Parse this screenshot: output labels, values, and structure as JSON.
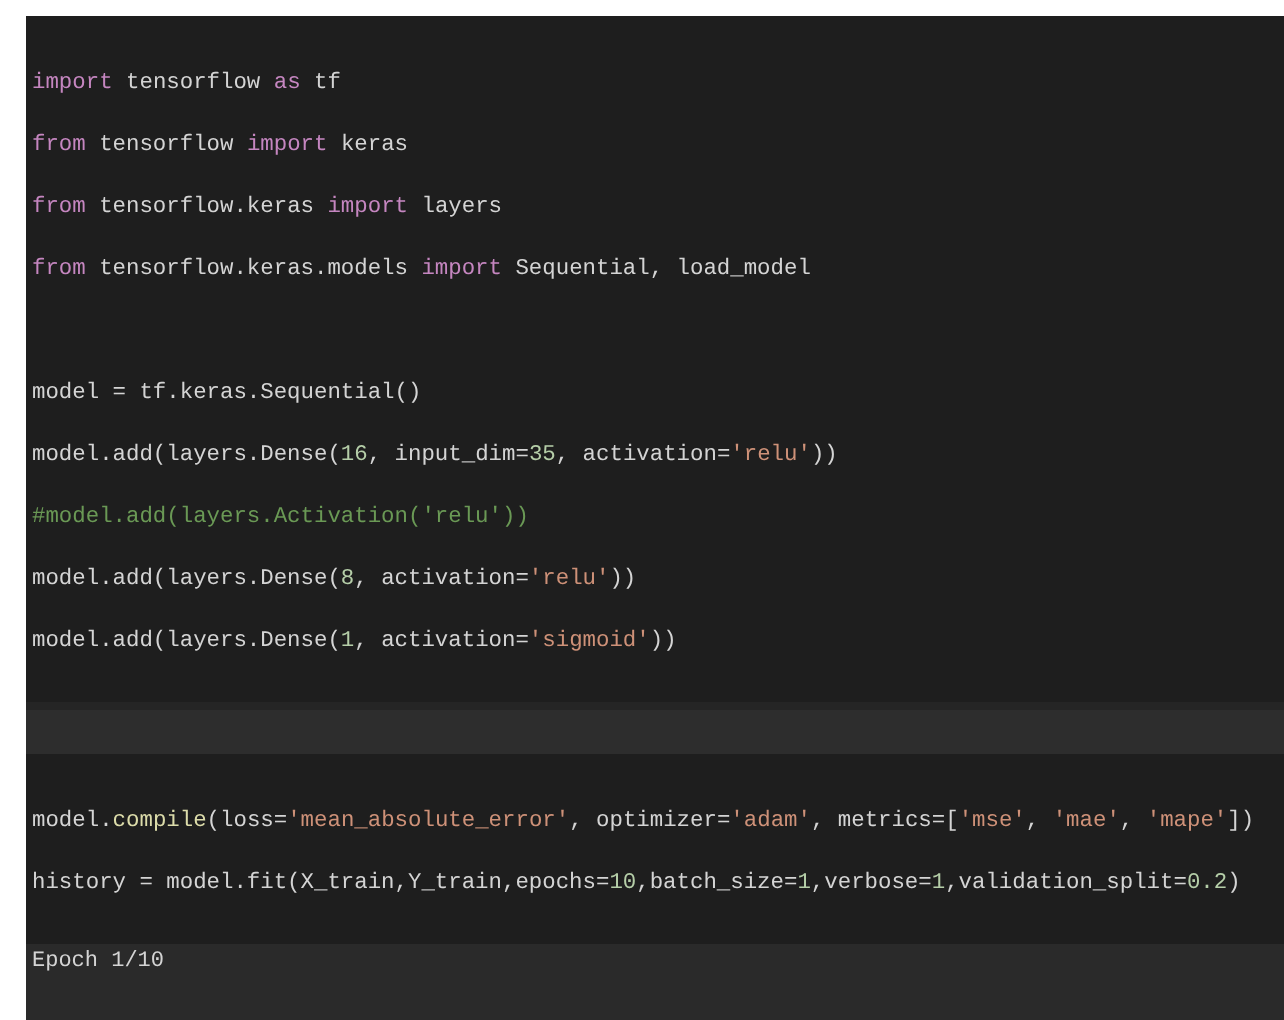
{
  "cells": [
    {
      "groups": [
        [
          [
            {
              "kind": "keyword",
              "text": "import"
            },
            {
              "kind": "plain",
              "text": " tensorflow "
            },
            {
              "kind": "keyword",
              "text": "as"
            },
            {
              "kind": "plain",
              "text": " tf"
            }
          ],
          [
            {
              "kind": "keyword",
              "text": "from"
            },
            {
              "kind": "plain",
              "text": " tensorflow "
            },
            {
              "kind": "keyword",
              "text": "import"
            },
            {
              "kind": "plain",
              "text": " keras"
            }
          ],
          [
            {
              "kind": "keyword",
              "text": "from"
            },
            {
              "kind": "plain",
              "text": " tensorflow.keras "
            },
            {
              "kind": "keyword",
              "text": "import"
            },
            {
              "kind": "plain",
              "text": " layers"
            }
          ],
          [
            {
              "kind": "keyword",
              "text": "from"
            },
            {
              "kind": "plain",
              "text": " tensorflow.keras.models "
            },
            {
              "kind": "keyword",
              "text": "import"
            },
            {
              "kind": "plain",
              "text": " Sequential, load_model"
            }
          ]
        ],
        [
          [
            {
              "kind": "plain",
              "text": "model = tf.keras.Sequential()"
            }
          ],
          [
            {
              "kind": "plain",
              "text": "model.add(layers.Dense("
            },
            {
              "kind": "number",
              "text": "16"
            },
            {
              "kind": "plain",
              "text": ", input_dim="
            },
            {
              "kind": "number",
              "text": "35"
            },
            {
              "kind": "plain",
              "text": ", activation="
            },
            {
              "kind": "string",
              "text": "'relu'"
            },
            {
              "kind": "plain",
              "text": "))"
            }
          ],
          [
            {
              "kind": "comment",
              "text": "#model.add(layers.Activation('relu'))"
            }
          ],
          [
            {
              "kind": "plain",
              "text": "model.add(layers.Dense("
            },
            {
              "kind": "number",
              "text": "8"
            },
            {
              "kind": "plain",
              "text": ", activation="
            },
            {
              "kind": "string",
              "text": "'relu'"
            },
            {
              "kind": "plain",
              "text": "))"
            }
          ],
          [
            {
              "kind": "plain",
              "text": "model.add(layers.Dense("
            },
            {
              "kind": "number",
              "text": "1"
            },
            {
              "kind": "plain",
              "text": ", activation="
            },
            {
              "kind": "string",
              "text": "'sigmoid'"
            },
            {
              "kind": "plain",
              "text": "))"
            }
          ]
        ]
      ]
    },
    {
      "groups": [
        [
          [
            {
              "kind": "plain",
              "text": "model."
            },
            {
              "kind": "function",
              "text": "compile"
            },
            {
              "kind": "plain",
              "text": "(loss="
            },
            {
              "kind": "string",
              "text": "'mean_absolute_error'"
            },
            {
              "kind": "plain",
              "text": ", optimizer="
            },
            {
              "kind": "string",
              "text": "'adam'"
            },
            {
              "kind": "plain",
              "text": ", metrics=["
            },
            {
              "kind": "string",
              "text": "'mse'"
            },
            {
              "kind": "plain",
              "text": ", "
            },
            {
              "kind": "string",
              "text": "'mae'"
            },
            {
              "kind": "plain",
              "text": ", "
            },
            {
              "kind": "string",
              "text": "'mape'"
            },
            {
              "kind": "plain",
              "text": "])"
            }
          ],
          [
            {
              "kind": "plain",
              "text": "history = model.fit(X_train,Y_train,epochs="
            },
            {
              "kind": "number",
              "text": "10"
            },
            {
              "kind": "plain",
              "text": ",batch_size="
            },
            {
              "kind": "number",
              "text": "1"
            },
            {
              "kind": "plain",
              "text": ",verbose="
            },
            {
              "kind": "number",
              "text": "1"
            },
            {
              "kind": "plain",
              "text": ",validation_split="
            },
            {
              "kind": "number",
              "text": "0.2"
            },
            {
              "kind": "plain",
              "text": ")"
            }
          ]
        ]
      ]
    }
  ],
  "output": "Epoch 1/10"
}
